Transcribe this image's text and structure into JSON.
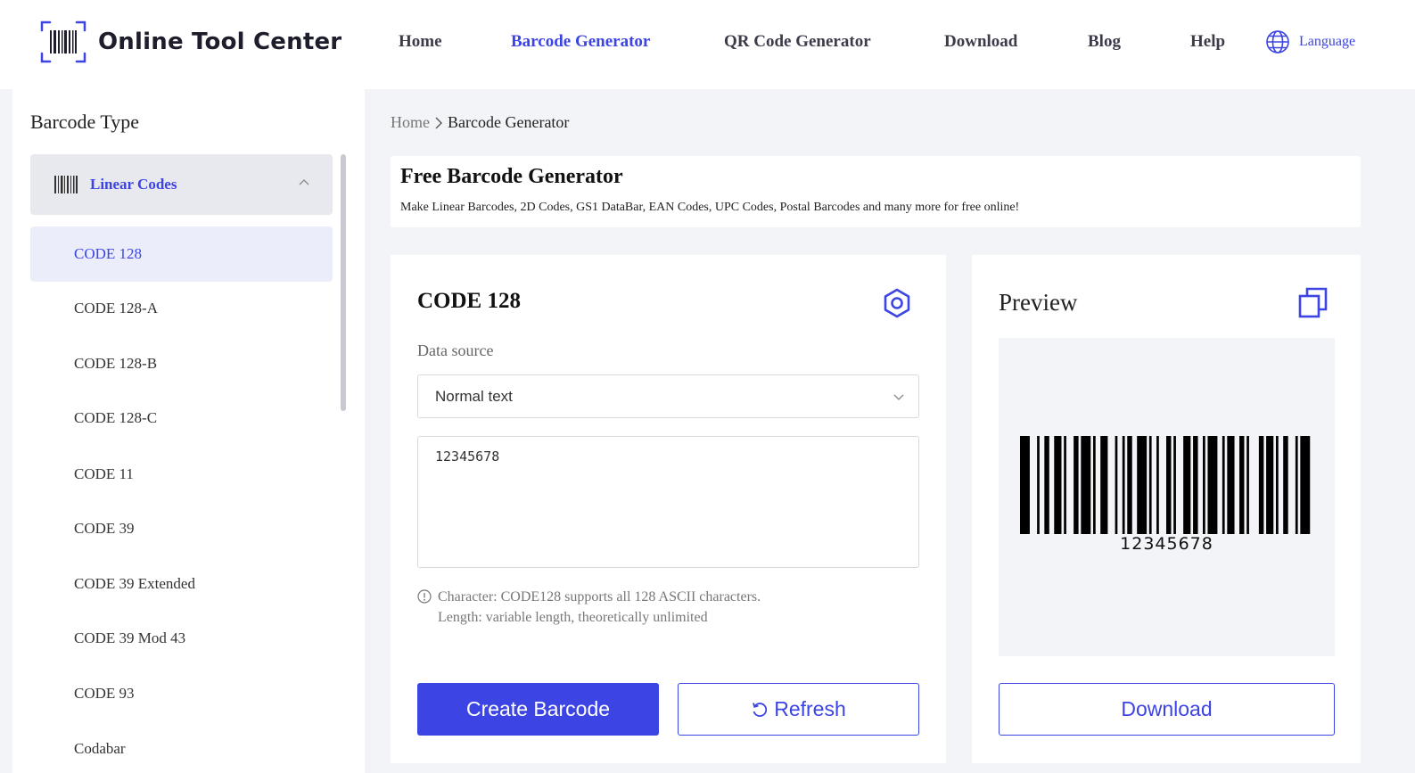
{
  "brand": {
    "name": "Online Tool Center",
    "accent": "#3c44e3"
  },
  "nav": {
    "items": [
      {
        "label": "Home",
        "active": false
      },
      {
        "label": "Barcode Generator",
        "active": true
      },
      {
        "label": "QR Code Generator",
        "active": false
      },
      {
        "label": "Download",
        "active": false
      },
      {
        "label": "Blog",
        "active": false
      },
      {
        "label": "Help",
        "active": false
      }
    ],
    "language": "Language"
  },
  "sidebar": {
    "title": "Barcode Type",
    "group": {
      "label": "Linear Codes",
      "expanded": true
    },
    "items": [
      {
        "label": "CODE 128",
        "active": true
      },
      {
        "label": "CODE 128-A"
      },
      {
        "label": "CODE 128-B"
      },
      {
        "label": "CODE 128-C"
      },
      {
        "label": "CODE 11"
      },
      {
        "label": "CODE 39"
      },
      {
        "label": "CODE 39 Extended"
      },
      {
        "label": "CODE 39 Mod 43"
      },
      {
        "label": "CODE 93"
      },
      {
        "label": "Codabar"
      }
    ]
  },
  "breadcrumb": {
    "home": "Home",
    "current": "Barcode Generator"
  },
  "intro": {
    "title": "Free Barcode Generator",
    "subtitle": "Make Linear Barcodes, 2D Codes, GS1 DataBar, EAN Codes, UPC Codes, Postal Barcodes and many more for free online!"
  },
  "form": {
    "code_title": "CODE 128",
    "data_source_label": "Data source",
    "data_source_value": "Normal text",
    "data_value": "12345678",
    "hint_line1": "Character: CODE128 supports all 128 ASCII characters.",
    "hint_line2": "Length: variable length, theoretically unlimited",
    "create_label": "Create Barcode",
    "refresh_label": "Refresh"
  },
  "preview": {
    "title": "Preview",
    "barcode_text": "12345678",
    "download_label": "Download"
  }
}
